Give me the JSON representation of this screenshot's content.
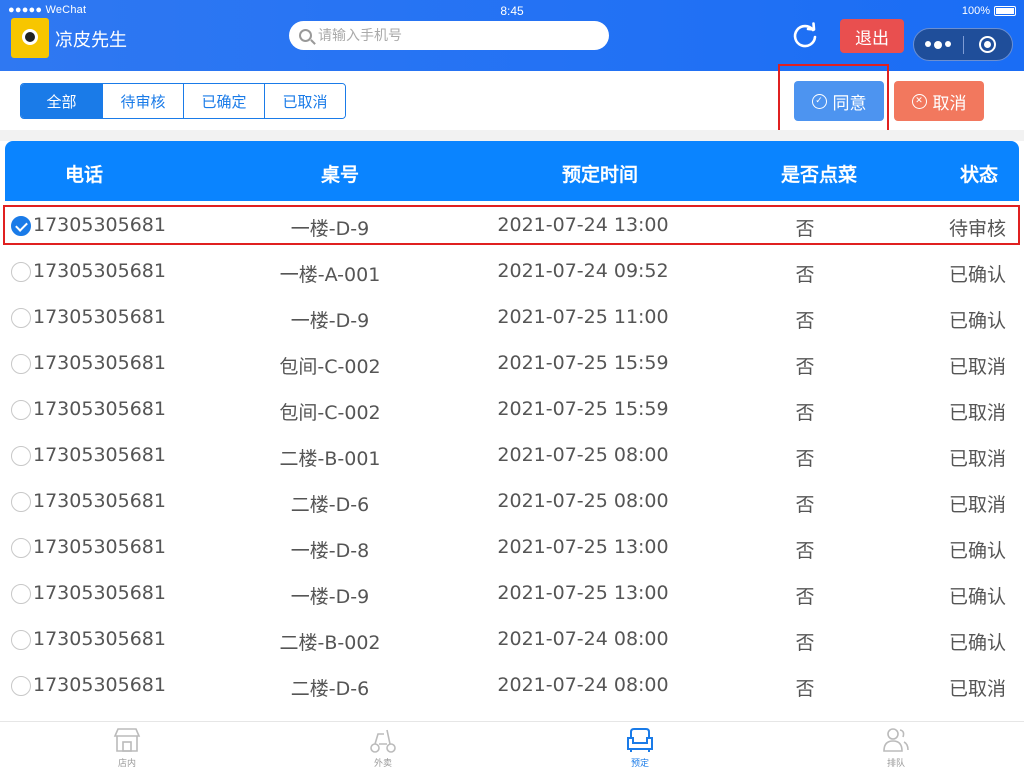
{
  "status_bar": {
    "carrier": "●●●●● WeChat",
    "time": "8:45",
    "battery": "100%"
  },
  "header": {
    "app_title": "凉皮先生",
    "search_placeholder": "请输入手机号",
    "exit_label": "退出"
  },
  "filter_tabs": [
    {
      "label": "全部",
      "active": true
    },
    {
      "label": "待审核",
      "active": false
    },
    {
      "label": "已确定",
      "active": false
    },
    {
      "label": "已取消",
      "active": false
    }
  ],
  "actions": {
    "agree_label": "同意",
    "cancel_label": "取消"
  },
  "table": {
    "headers": {
      "phone": "电话",
      "table": "桌号",
      "time": "预定时间",
      "ordered": "是否点菜",
      "status": "状态"
    },
    "rows": [
      {
        "phone": "17305305681",
        "table": "一楼-D-9",
        "time": "2021-07-24 13:00",
        "ordered": "否",
        "status": "待审核",
        "selected": true
      },
      {
        "phone": "17305305681",
        "table": "一楼-A-001",
        "time": "2021-07-24 09:52",
        "ordered": "否",
        "status": "已确认",
        "selected": false
      },
      {
        "phone": "17305305681",
        "table": "一楼-D-9",
        "time": "2021-07-25 11:00",
        "ordered": "否",
        "status": "已确认",
        "selected": false
      },
      {
        "phone": "17305305681",
        "table": "包间-C-002",
        "time": "2021-07-25 15:59",
        "ordered": "否",
        "status": "已取消",
        "selected": false
      },
      {
        "phone": "17305305681",
        "table": "包间-C-002",
        "time": "2021-07-25 15:59",
        "ordered": "否",
        "status": "已取消",
        "selected": false
      },
      {
        "phone": "17305305681",
        "table": "二楼-B-001",
        "time": "2021-07-25 08:00",
        "ordered": "否",
        "status": "已取消",
        "selected": false
      },
      {
        "phone": "17305305681",
        "table": "二楼-D-6",
        "time": "2021-07-25 08:00",
        "ordered": "否",
        "status": "已取消",
        "selected": false
      },
      {
        "phone": "17305305681",
        "table": "一楼-D-8",
        "time": "2021-07-25 13:00",
        "ordered": "否",
        "status": "已确认",
        "selected": false
      },
      {
        "phone": "17305305681",
        "table": "一楼-D-9",
        "time": "2021-07-25 13:00",
        "ordered": "否",
        "status": "已确认",
        "selected": false
      },
      {
        "phone": "17305305681",
        "table": "二楼-B-002",
        "time": "2021-07-24 08:00",
        "ordered": "否",
        "status": "已确认",
        "selected": false
      },
      {
        "phone": "17305305681",
        "table": "二楼-D-6",
        "time": "2021-07-24 08:00",
        "ordered": "否",
        "status": "已取消",
        "selected": false
      }
    ]
  },
  "bottom_nav": [
    {
      "label": "店内",
      "icon": "store-icon",
      "active": false
    },
    {
      "label": "外卖",
      "icon": "scooter-icon",
      "active": false
    },
    {
      "label": "预定",
      "icon": "sofa-icon",
      "active": true
    },
    {
      "label": "排队",
      "icon": "people-icon",
      "active": false
    }
  ],
  "colors": {
    "primary": "#1a7be8",
    "header_bg": "#0a84ff",
    "danger": "#e94f4f",
    "cancel": "#f2785e",
    "agree": "#4d94f0"
  }
}
